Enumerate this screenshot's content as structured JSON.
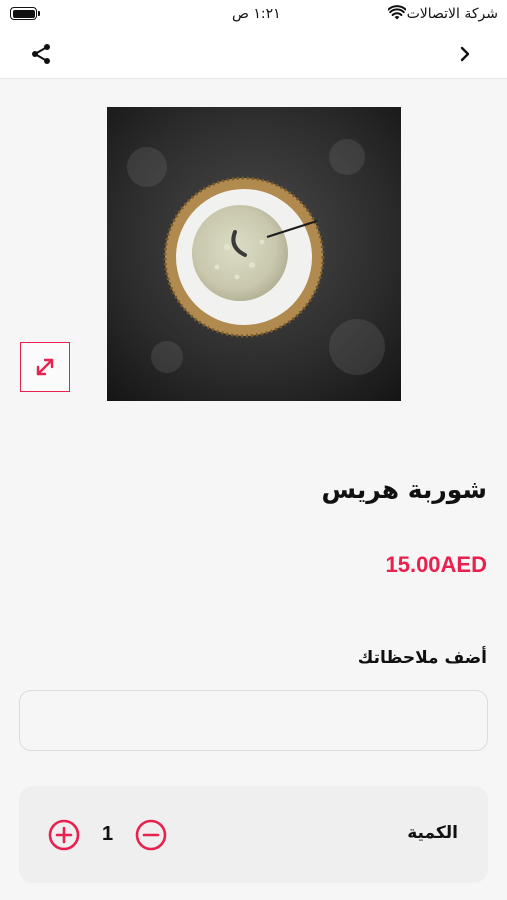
{
  "status_bar": {
    "carrier": "شركة الاتصالات",
    "time": "١:٢١ ص"
  },
  "nav": {
    "share_icon": "share-icon",
    "back_icon": "chevron-right-icon"
  },
  "product": {
    "image_description": "harees-soup-bowl",
    "name": "شوربة هريس",
    "price": "15.00AED"
  },
  "notes": {
    "label": "أضف ملاحظاتك",
    "value": ""
  },
  "quantity": {
    "label": "الكمية",
    "value": "1"
  },
  "colors": {
    "accent": "#e8214f"
  }
}
